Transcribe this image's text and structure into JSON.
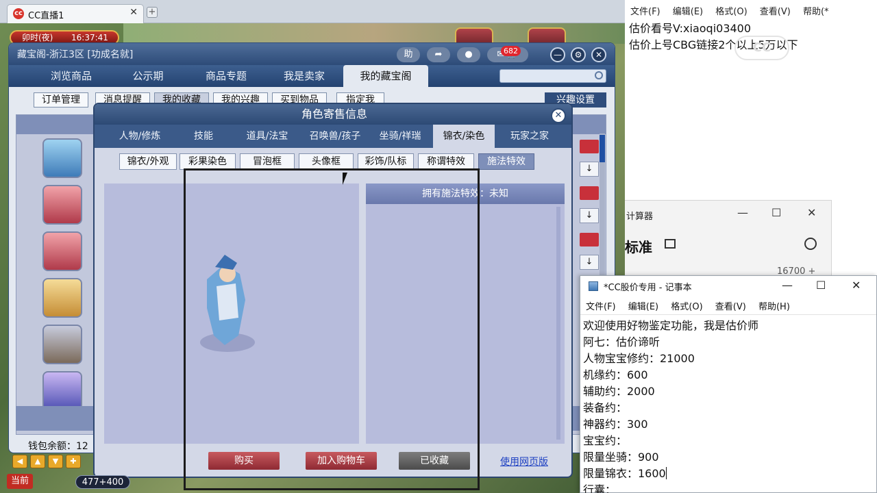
{
  "browser": {
    "tab_title": "CC直播1",
    "tab_close": "✕",
    "new_tab": "+"
  },
  "game": {
    "time_label": "卯时(夜)",
    "clock": "16:37:41",
    "window_title": "藏宝阁-浙江3区 [功成名就]",
    "help_label": "助",
    "chat_count": "682",
    "nav": [
      "浏览商品",
      "公示期",
      "商品专题",
      "我是卖家",
      "我的藏宝阁"
    ],
    "subnav": [
      "订单管理",
      "消息提醒",
      "我的收藏",
      "我的兴趣",
      "买到物品",
      "指定我"
    ],
    "interest_settings": "兴趣设置",
    "row_prefix": "1",
    "wallet_label": "钱包余额：12",
    "hud_now": "当前",
    "hud_counter": "477+400",
    "hud_arrows": [
      "◀",
      "▲",
      "▼",
      "✚"
    ]
  },
  "modal": {
    "title": "角色寄售信息",
    "close": "✕",
    "tabs": [
      "人物/修炼",
      "技能",
      "道具/法宝",
      "召唤兽/孩子",
      "坐骑/祥瑞",
      "锦衣/染色",
      "玩家之家"
    ],
    "active_tab": "锦衣/染色",
    "subtabs": [
      "锦衣/外观",
      "彩果染色",
      "冒泡框",
      "头像框",
      "彩饰/队标",
      "称谓特效",
      "施法特效"
    ],
    "active_subtab": "施法特效",
    "effect_header": "拥有施法特效：未知",
    "buttons": {
      "buy": "购买",
      "add_cart": "加入购物车",
      "favorited": "已收藏",
      "web_version": "使用网页版"
    }
  },
  "notepad_top": {
    "menu": [
      "文件(F)",
      "编辑(E)",
      "格式(O)",
      "查看(V)",
      "帮助(*"
    ],
    "lines": [
      "估价看号V:xiaoqi03400",
      "估价上号CBG链接2个以上5万以下"
    ],
    "watermark": "CC"
  },
  "calculator": {
    "title": "计算器",
    "mode": "标准",
    "expression": "16700 +",
    "controls": [
      "—",
      "☐",
      "✕"
    ]
  },
  "notepad": {
    "title": "*CC股价专用 - 记事本",
    "controls": [
      "—",
      "☐",
      "✕"
    ],
    "menu": [
      "文件(F)",
      "编辑(E)",
      "格式(O)",
      "查看(V)",
      "帮助(H)"
    ],
    "lines": [
      "欢迎使用好物鉴定功能，我是估价师",
      "阿七：估价谛听",
      "人物宝宝修约：21000",
      "机缘约：600",
      "辅助约：2000",
      "装备约：",
      "神器约：300",
      "宝宝约：",
      "限量坐骑：900",
      "限量锦衣：1600",
      "行囊："
    ]
  },
  "colors": {
    "nav_blue": "#2d4b78",
    "buy_red": "#8f2a33",
    "link_blue": "#1c3fc2"
  }
}
